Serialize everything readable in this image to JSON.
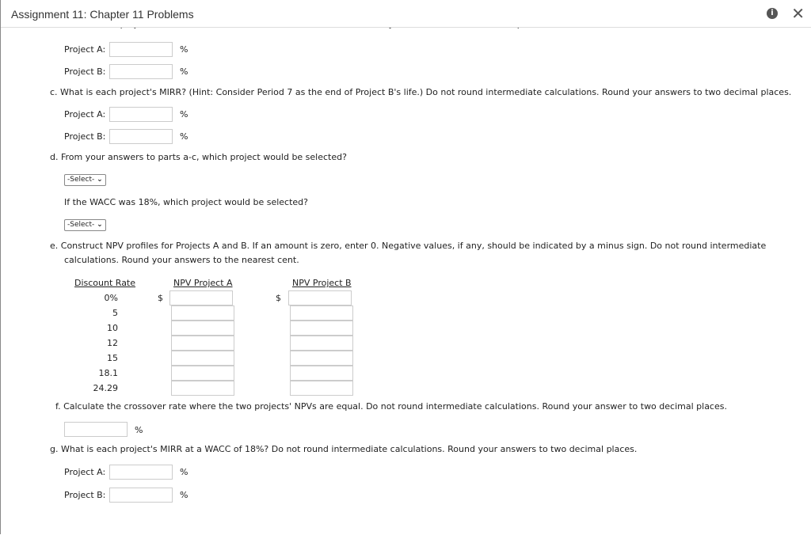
{
  "header": {
    "title": "Assignment 11: Chapter 11 Problems",
    "info_icon": "info-icon",
    "close_icon": "close-icon"
  },
  "part_b": {
    "prompt": "b. What is each project's IRR? Do not round intermediate calculations. Round your answers to two decimal places.",
    "a_label": "Project A:",
    "b_label": "Project B:",
    "unit": "%"
  },
  "part_c": {
    "prompt": "c. What is each project's MIRR? (Hint: Consider Period 7 as the end of Project B's life.) Do not round intermediate calculations. Round your answers to two decimal places.",
    "a_label": "Project A:",
    "b_label": "Project B:",
    "unit": "%"
  },
  "part_d": {
    "prompt": "d. From your answers to parts a-c, which project would be selected?",
    "select1": "-Select-",
    "prompt2": "If the WACC was 18%, which project would be selected?",
    "select2": "-Select-"
  },
  "part_e": {
    "prompt1": "e. Construct NPV profiles for Projects A and B. If an amount is zero, enter 0. Negative values, if any, should be indicated by a minus sign. Do not round intermediate",
    "prompt2": "calculations. Round your answers to the nearest cent.",
    "col_rate": "Discount Rate",
    "col_a": "NPV Project A",
    "col_b": "NPV Project B",
    "currency": "$",
    "rates": [
      "0%",
      "5",
      "10",
      "12",
      "15",
      "18.1",
      "24.29"
    ]
  },
  "part_f": {
    "prompt": "f. Calculate the crossover rate where the two projects' NPVs are equal. Do not round intermediate calculations. Round your answer to two decimal places.",
    "unit": "%"
  },
  "part_g": {
    "prompt": "g. What is each project's MIRR at a WACC of 18%? Do not round intermediate calculations. Round your answers to two decimal places.",
    "a_label": "Project A:",
    "b_label": "Project B:",
    "unit": "%"
  }
}
